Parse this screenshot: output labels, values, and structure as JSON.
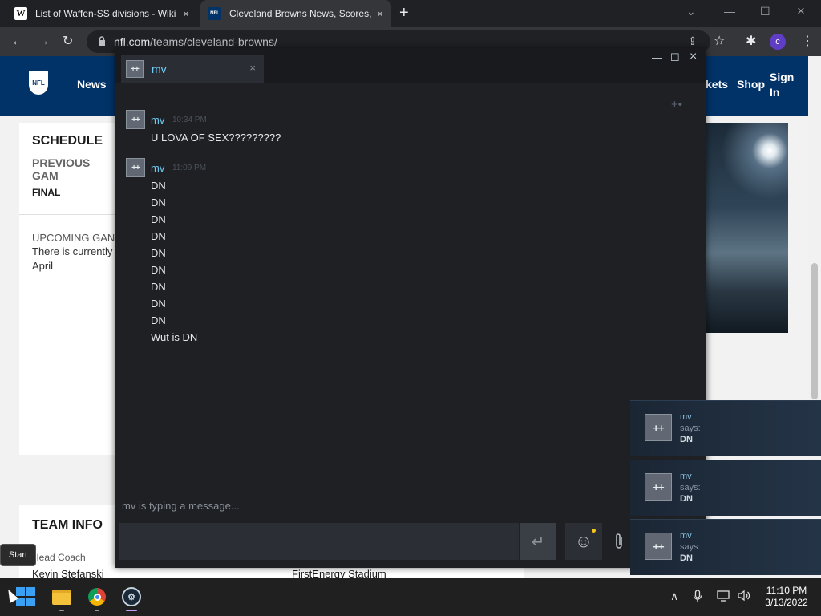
{
  "browser": {
    "tabs": [
      {
        "label": "List of Waffen-SS divisions - Wiki",
        "favicon": "W"
      },
      {
        "label": "Cleveland Browns News, Scores, ",
        "favicon": "NFL"
      }
    ],
    "url_host": "nfl.com",
    "url_path": "/teams/cleveland-browns/"
  },
  "nfl": {
    "logo": "NFL",
    "nav": [
      "News",
      "kets",
      "Shop",
      "Sign In"
    ],
    "schedule_title": "SCHEDULE",
    "previous_games": "PREVIOUS GAM",
    "final": "FINAL",
    "upcoming": "UPCOMING GAN",
    "no_game_text": "There is currently available on April",
    "team_info_title": "TEAM INFO",
    "head_coach_label": "Head Coach",
    "head_coach": "Kevin Stefanski",
    "stadium": "FirstEnergy Stadium"
  },
  "chat": {
    "tab_name": "mv",
    "avatar": "++",
    "messages": [
      {
        "author": "mv",
        "time": "10:34 PM",
        "lines": [
          "U LOVA OF SEX?????????"
        ]
      },
      {
        "author": "mv",
        "time": "11:09 PM",
        "lines": [
          "DN",
          "DN",
          "DN",
          "DN",
          "DN",
          "DN",
          "DN",
          "DN",
          "DN",
          "Wut is DN"
        ]
      }
    ],
    "typing": "mv is typing a message..."
  },
  "notifications": [
    {
      "name": "mv",
      "says": "says:",
      "text": "DN"
    },
    {
      "name": "mv",
      "says": "says:",
      "text": "DN"
    },
    {
      "name": "mv",
      "says": "says:",
      "text": "DN"
    }
  ],
  "tooltip": "Start",
  "taskbar": {
    "time": "11:10 PM",
    "date": "3/13/2022"
  },
  "colors": {
    "nfl_blue": "#013369",
    "steam_name": "#6dcff6",
    "chat_bg": "#1e2024"
  },
  "icons": {
    "back": "←",
    "forward": "→",
    "reload": "↻",
    "lock": "🔒",
    "share": "⇪",
    "star": "☆",
    "extensions": "✱",
    "menu": "⋮",
    "profile": "c",
    "close": "×",
    "plus": "+",
    "minimize": "—",
    "maximize": "☐",
    "chevron": "⌄",
    "enter": "↵",
    "emoji": "☺",
    "attach": "⌇",
    "add_friend": "+•",
    "tray_up": "∧",
    "mic": "🎙",
    "network": "▭",
    "volume": "🔊"
  }
}
